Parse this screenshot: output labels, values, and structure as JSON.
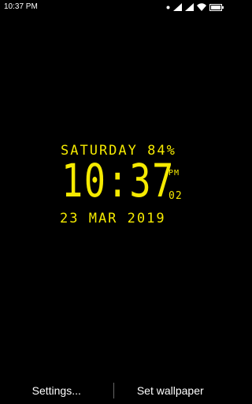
{
  "status_bar": {
    "time": "10:37 PM",
    "icons": [
      "dot-icon",
      "signal-icon",
      "signal-icon",
      "wifi-icon",
      "battery-icon"
    ]
  },
  "clock": {
    "day_line": "SATURDAY 84%",
    "time": "10:37",
    "ampm": "PM",
    "seconds": "02",
    "date_line": "23 MAR 2019",
    "color": "#f5ea00"
  },
  "bottom_bar": {
    "settings_label": "Settings...",
    "wallpaper_label": "Set wallpaper"
  }
}
